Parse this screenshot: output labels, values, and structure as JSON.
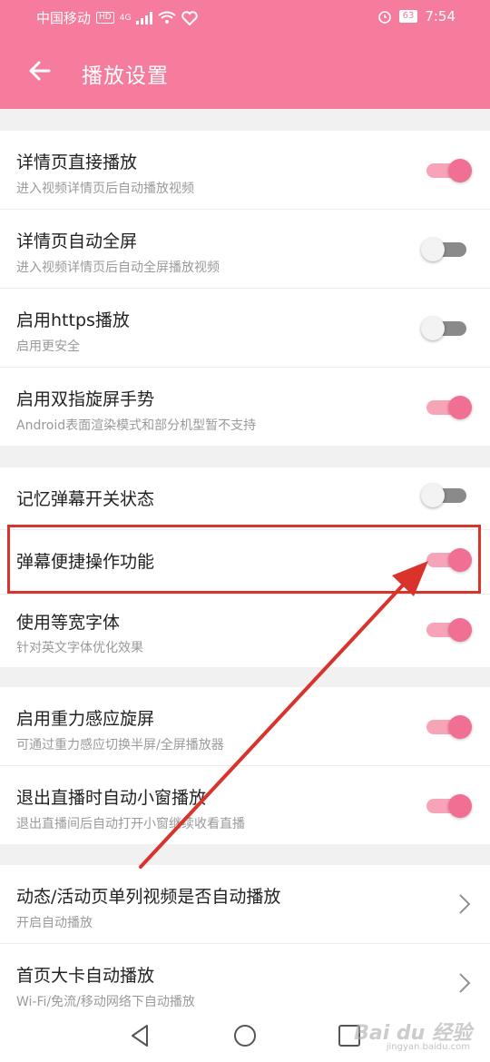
{
  "status_bar": {
    "carrier": "中国移动",
    "hd": "HD",
    "network": "4G",
    "battery": "63",
    "time": "7:54"
  },
  "header": {
    "back_icon": "arrow-left-icon",
    "title": "播放设置",
    "color": "#f57c9c"
  },
  "sections": [
    {
      "items": [
        {
          "title": "详情页直接播放",
          "subtitle": "进入视频详情页后自动播放视频",
          "on": true
        },
        {
          "title": "详情页自动全屏",
          "subtitle": "进入视频详情页后自动全屏播放视频",
          "on": false
        },
        {
          "title": "启用https播放",
          "subtitle": "启用更安全",
          "on": false
        },
        {
          "title": "启用双指旋屏手势",
          "subtitle": "Android表面渲染模式和部分机型暂不支持",
          "on": true
        }
      ]
    },
    {
      "items": [
        {
          "title": "记忆弹幕开关状态",
          "subtitle": "",
          "on": false
        },
        {
          "title": "弹幕便捷操作功能",
          "subtitle": "",
          "on": true
        },
        {
          "title": "使用等宽字体",
          "subtitle": "针对英文字体优化效果",
          "on": true
        }
      ]
    },
    {
      "items": [
        {
          "title": "启用重力感应旋屏",
          "subtitle": "可通过重力感应切换半屏/全屏播放器",
          "on": true
        },
        {
          "title": "退出直播时自动小窗播放",
          "subtitle": "退出直播间后自动打开小窗继续收看直播",
          "on": true
        }
      ]
    },
    {
      "items": [
        {
          "title": "动态/活动页单列视频是否自动播放",
          "subtitle": "开启自动播放",
          "chevron": true
        },
        {
          "title": "首页大卡自动播放",
          "subtitle": "Wi-Fi/免流/移动网络下自动播放",
          "chevron": true
        }
      ]
    }
  ],
  "annotation": {
    "highlight_color": "#d9332b"
  },
  "watermark": {
    "text": "Bai du 经验",
    "sub": "jingyan.baidu.com"
  },
  "navbar": {
    "back_icon": "triangle-back-icon",
    "home_icon": "circle-home-icon",
    "recent_icon": "square-recent-icon"
  }
}
